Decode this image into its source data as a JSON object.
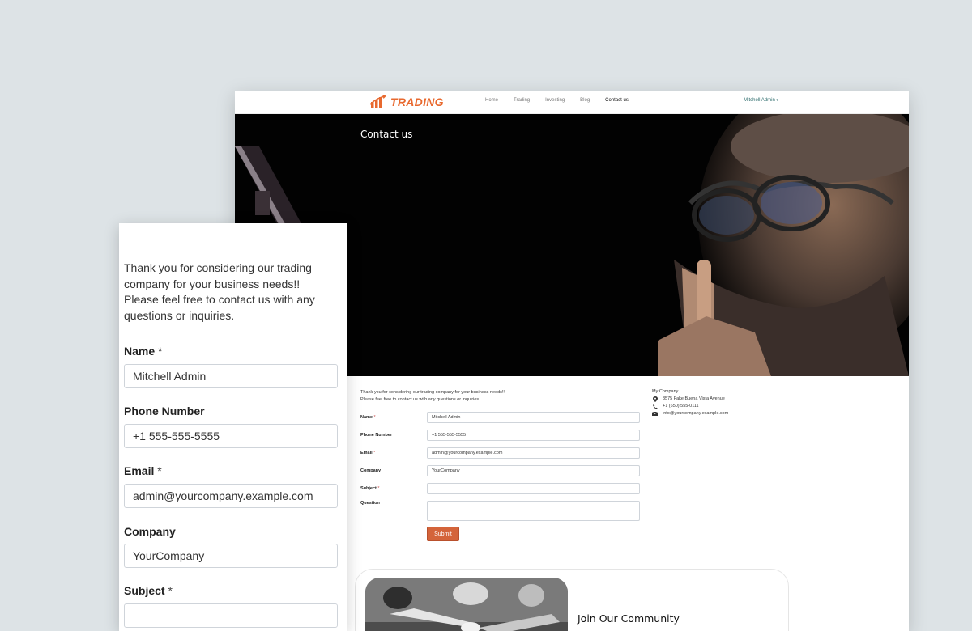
{
  "site": {
    "brand": "TRADING",
    "nav": [
      "Home",
      "Trading",
      "Investing",
      "Blog",
      "Contact us"
    ],
    "active_nav": "Contact us",
    "user": "Mitchell Admin",
    "hero_title": "Contact us"
  },
  "form": {
    "intro_line1": "Thank you for considering our trading company for your business needs!!",
    "intro_line2": "Please feel free to contact us with any questions or inquiries.",
    "name_label": "Name",
    "name_value": "Mitchell Admin",
    "phone_label": "Phone Number",
    "phone_value": "+1 555-555-5555",
    "email_label": "Email",
    "email_value": "admin@yourcompany.example.com",
    "company_label": "Company",
    "company_value": "YourCompany",
    "subject_label": "Subject",
    "subject_value": "",
    "question_label": "Question",
    "question_value": "",
    "required_mark": "*",
    "submit": "Submit"
  },
  "company_info": {
    "title": "My Company",
    "address": "3575 Fake Buena Vista Avenue",
    "phone": "+1 (650) 555-0111",
    "email": "info@yourcompany.example.com",
    "icons": [
      "map-marker-icon",
      "phone-icon",
      "envelope-icon"
    ]
  },
  "community": {
    "title": "Join Our Community"
  },
  "zoom": {
    "intro": "Thank you for considering our trading company for your business needs!! Please feel free to contact us with any questions or inquiries."
  },
  "colors": {
    "brand": "#e8692f",
    "submit": "#d4643a",
    "background": "#dde3e6"
  }
}
